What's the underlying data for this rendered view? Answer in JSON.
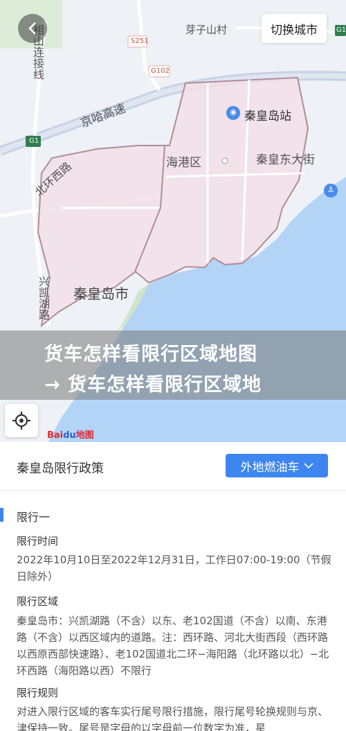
{
  "map": {
    "labels": {
      "yashan": "芽子山村",
      "qinhuangdao_station": "秦皇岛站",
      "haigang": "海港区",
      "qinhuang_east": "秦皇东大街",
      "qinhuangdao_city": "秦皇岛市",
      "jingha": "京哈高速",
      "beihuan": "北环西路",
      "xinkai": "兴凯湖路",
      "xiangshan": "相山连接线",
      "s251": "S251",
      "g102": "G102",
      "g1": "G1",
      "g1_right": "G1"
    },
    "switch_city": "切换城市",
    "baidu_logo_bai": "Bai",
    "baidu_logo_du": "du",
    "baidu_logo_map": "地图"
  },
  "banner": {
    "line1": "货车怎样看限行区域地图",
    "line2": "→ 货车怎样看限行区域地"
  },
  "policy": {
    "title": "秦皇岛限行政策",
    "vehicle_type": "外地燃油车",
    "section_title": "限行一",
    "time_label": "限行时间",
    "time_text": "2022年10月10日至2022年12月31日，工作日07:00-19:00（节假日除外）",
    "area_label": "限行区域",
    "area_text": "秦皇岛市：兴凯湖路（不含）以东、老102国道（不含）以南、东港路（不含）以西区域内的道路。注：西环路、河北大街西段（西环路以西原西部快速路）、老102国道北二环−海阳路（北环路以北）−北环西路（海阳路以西）不限行",
    "rule_label": "限行规则",
    "rule_text": "对进入限行区域的客车实行尾号限行措施，限行尾号轮换规则与京、津保持一致。尾号是字母的以字母前一位数字为准，星"
  },
  "colors": {
    "accent": "#3d85f0",
    "restricted_area": "#f2dfe6",
    "sea": "#b3d4f7"
  }
}
